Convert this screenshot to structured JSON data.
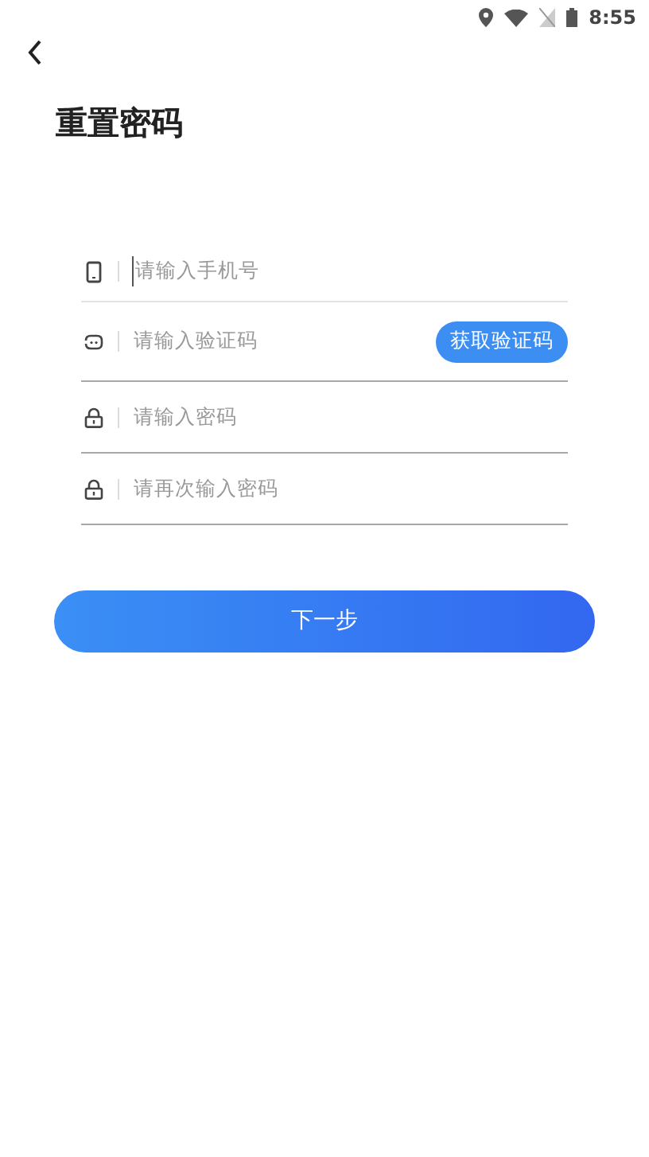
{
  "status_bar": {
    "time": "8:55"
  },
  "title": "重置密码",
  "fields": [
    {
      "kind": "phone",
      "placeholder": "请输入手机号",
      "focused": true
    },
    {
      "kind": "code",
      "placeholder": "请输入验证码",
      "focused": false,
      "action": "获取验证码"
    },
    {
      "kind": "lock",
      "placeholder": "请输入密码",
      "focused": false
    },
    {
      "kind": "lock",
      "placeholder": "请再次输入密码",
      "focused": false
    }
  ],
  "submit": "下一步"
}
